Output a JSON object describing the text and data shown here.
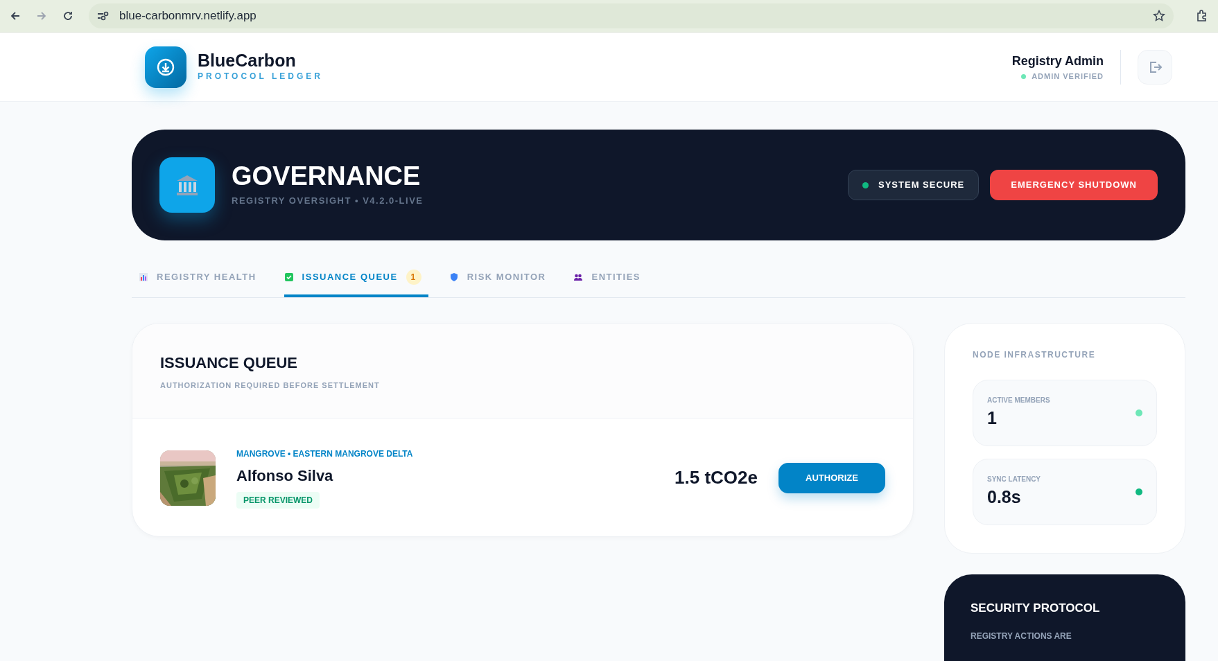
{
  "browser": {
    "url": "blue-carbonmrv.netlify.app"
  },
  "brand": {
    "name": "BlueCarbon",
    "tagline": "PROTOCOL LEDGER"
  },
  "user": {
    "name": "Registry Admin",
    "status": "ADMIN VERIFIED"
  },
  "banner": {
    "title": "GOVERNANCE",
    "subtitle": "REGISTRY OVERSIGHT • V4.2.0-LIVE",
    "status": "SYSTEM SECURE",
    "action": "EMERGENCY SHUTDOWN"
  },
  "tabs": [
    {
      "label": "REGISTRY HEALTH",
      "kind": "chart",
      "selected": false
    },
    {
      "label": "ISSUANCE QUEUE",
      "kind": "check",
      "selected": true,
      "count": "1"
    },
    {
      "label": "RISK MONITOR",
      "kind": "shield",
      "selected": false
    },
    {
      "label": "ENTITIES",
      "kind": "people",
      "selected": false
    }
  ],
  "queue": {
    "title": "ISSUANCE QUEUE",
    "subtitle": "AUTHORIZATION REQUIRED BEFORE SETTLEMENT",
    "items": [
      {
        "kind": "picture",
        "location": "MANGROVE • EASTERN MANGROVE DELTA",
        "name": "Alfonso Silva",
        "tag": "PEER REVIEWED",
        "amount": "1.5 tCO2e",
        "action": "AUTHORIZE"
      }
    ]
  },
  "infrastructure": {
    "title": "NODE INFRASTRUCTURE",
    "metrics": [
      {
        "label": "ACTIVE MEMBERS",
        "value": "1",
        "color": "#6ee7b7"
      },
      {
        "label": "SYNC LATENCY",
        "value": "0.8s",
        "color": "#10b981"
      }
    ]
  },
  "security": {
    "title": "SECURITY PROTOCOL",
    "text": "REGISTRY ACTIONS ARE"
  }
}
